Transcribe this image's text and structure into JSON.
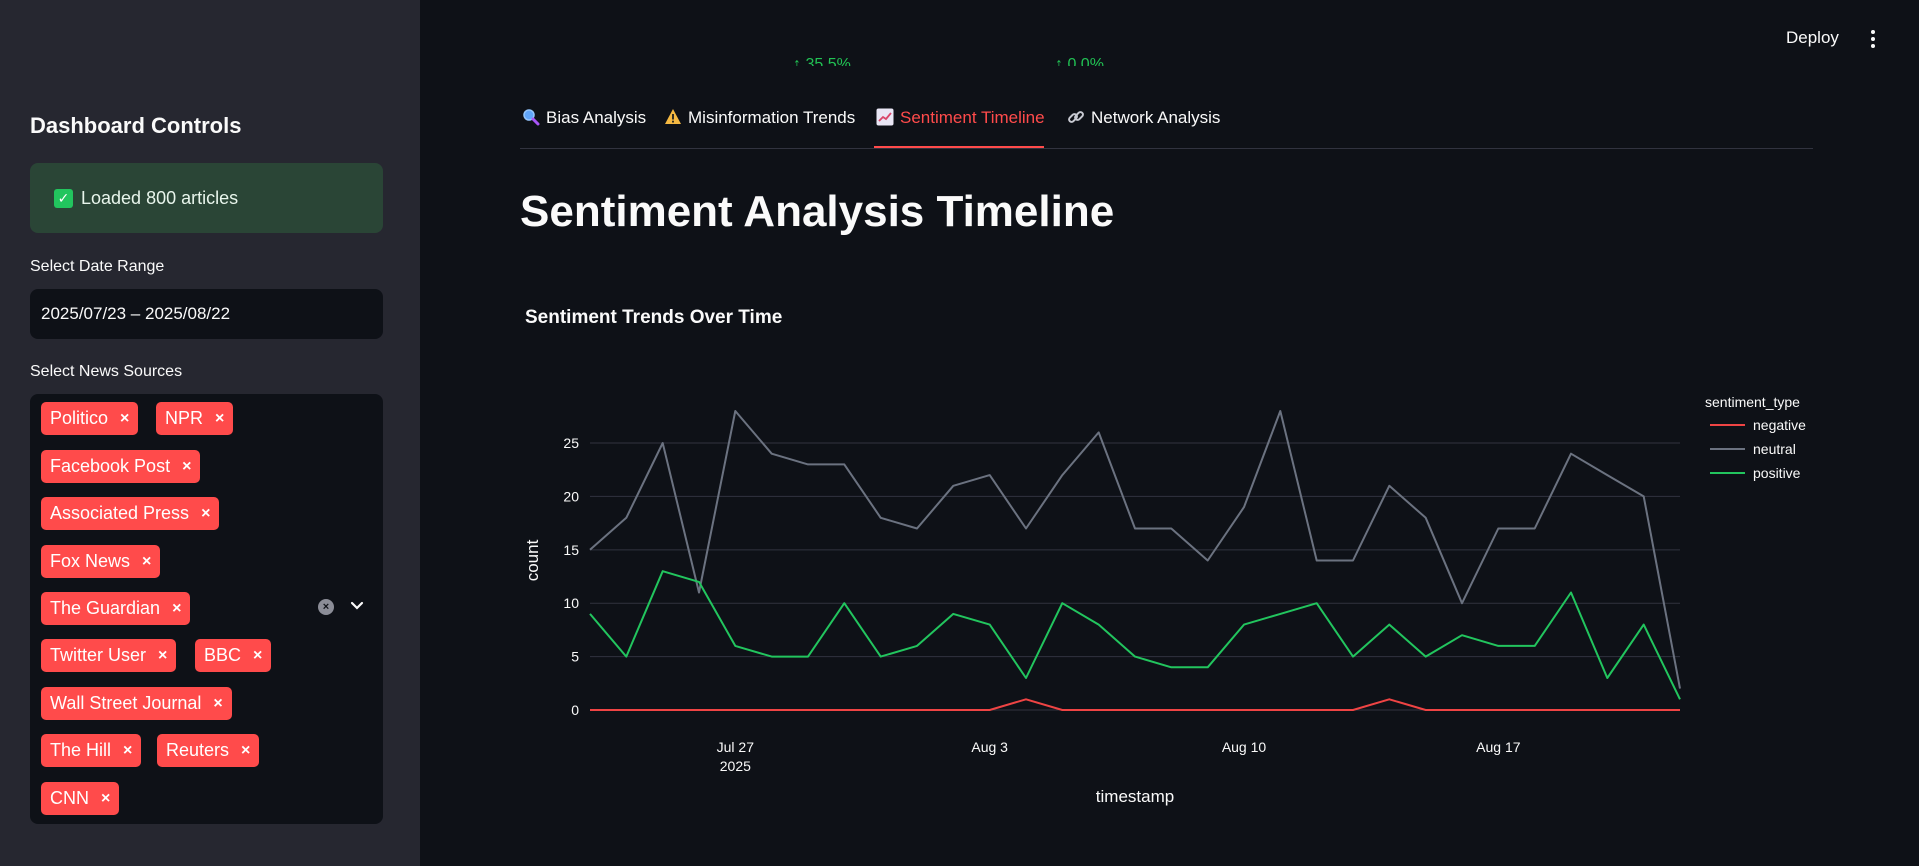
{
  "header": {
    "deploy_label": "Deploy"
  },
  "sidebar": {
    "title": "Dashboard Controls",
    "status": "Loaded 800 articles",
    "date_label": "Select Date Range",
    "date_value": "2025/07/23 – 2025/08/22",
    "sources_label": "Select News Sources",
    "sources": [
      "Politico",
      "NPR",
      "Facebook Post",
      "Associated Press",
      "Fox News",
      "The Guardian",
      "Twitter User",
      "BBC",
      "Wall Street Journal",
      "The Hill",
      "Reuters",
      "CNN"
    ],
    "chip_remove": "×"
  },
  "tabs": [
    {
      "label": "Bias Analysis",
      "icon": "magnifier-icon",
      "active": false
    },
    {
      "label": "Misinformation Trends",
      "icon": "warning-icon",
      "active": false
    },
    {
      "label": "Sentiment Timeline",
      "icon": "chart-icon",
      "active": true
    },
    {
      "label": "Network Analysis",
      "icon": "link-icon",
      "active": false
    }
  ],
  "page": {
    "title": "Sentiment Analysis Timeline"
  },
  "colors": {
    "accent": "#ff4b4b",
    "success": "#21c354",
    "negative": "#ef4444",
    "neutral": "#6b7280",
    "positive": "#22c55e"
  },
  "chart_data": {
    "type": "line",
    "title": "Sentiment Trends Over Time",
    "xlabel": "timestamp",
    "ylabel": "count",
    "legend_title": "sentiment_type",
    "legend_position": "right",
    "grid": true,
    "x": [
      "2025-07-23",
      "2025-07-24",
      "2025-07-25",
      "2025-07-26",
      "2025-07-27",
      "2025-07-28",
      "2025-07-29",
      "2025-07-30",
      "2025-07-31",
      "2025-08-01",
      "2025-08-02",
      "2025-08-03",
      "2025-08-04",
      "2025-08-05",
      "2025-08-06",
      "2025-08-07",
      "2025-08-08",
      "2025-08-09",
      "2025-08-10",
      "2025-08-11",
      "2025-08-12",
      "2025-08-13",
      "2025-08-14",
      "2025-08-15",
      "2025-08-16",
      "2025-08-17",
      "2025-08-18",
      "2025-08-19",
      "2025-08-20",
      "2025-08-21",
      "2025-08-22"
    ],
    "x_ticks": [
      {
        "value": "2025-07-27",
        "label": "Jul 27",
        "sub": "2025"
      },
      {
        "value": "2025-08-03",
        "label": "Aug 3",
        "sub": ""
      },
      {
        "value": "2025-08-10",
        "label": "Aug 10",
        "sub": ""
      },
      {
        "value": "2025-08-17",
        "label": "Aug 17",
        "sub": ""
      }
    ],
    "y_ticks": [
      0,
      5,
      10,
      15,
      20,
      25
    ],
    "ylim": [
      -1.5,
      29.5
    ],
    "series": [
      {
        "name": "negative",
        "color": "#ef4444",
        "values": [
          0,
          0,
          0,
          0,
          0,
          0,
          0,
          0,
          0,
          0,
          0,
          0,
          1,
          0,
          0,
          0,
          0,
          0,
          0,
          0,
          0,
          0,
          1,
          0,
          0,
          0,
          0,
          0,
          0,
          0,
          0
        ]
      },
      {
        "name": "neutral",
        "color": "#6b7280",
        "values": [
          15,
          18,
          25,
          11,
          28,
          24,
          23,
          23,
          18,
          17,
          21,
          22,
          17,
          22,
          26,
          17,
          17,
          14,
          19,
          28,
          14,
          14,
          21,
          18,
          10,
          17,
          17,
          24,
          22,
          20,
          2
        ]
      },
      {
        "name": "positive",
        "color": "#22c55e",
        "values": [
          9,
          5,
          13,
          12,
          6,
          5,
          5,
          10,
          5,
          6,
          9,
          8,
          3,
          10,
          8,
          5,
          4,
          4,
          8,
          9,
          10,
          5,
          8,
          5,
          7,
          6,
          6,
          11,
          3,
          8,
          1
        ]
      }
    ]
  }
}
